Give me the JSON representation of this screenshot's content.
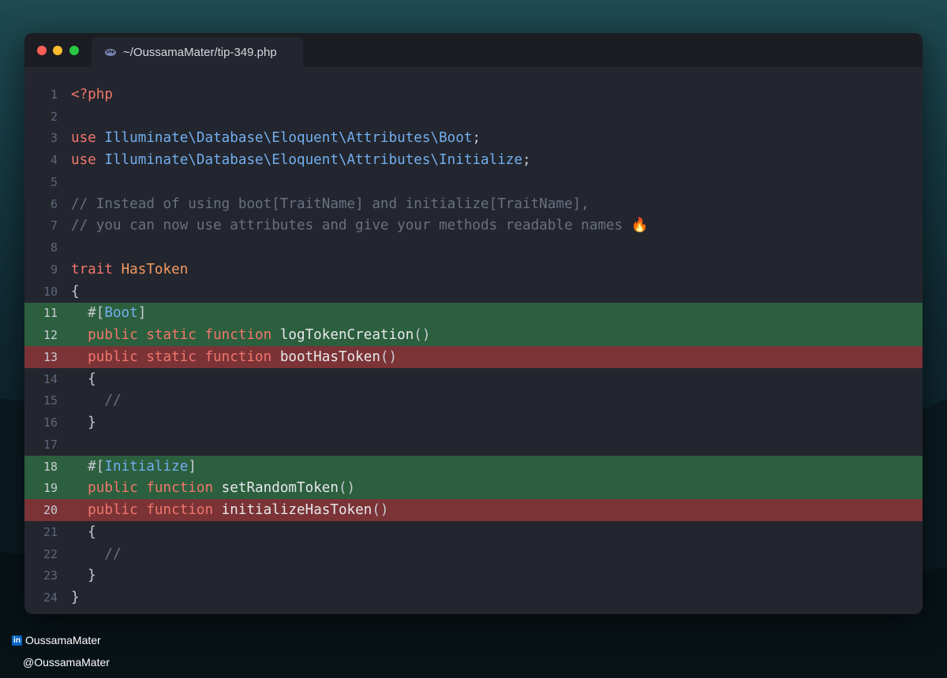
{
  "window": {
    "tab_title": "~/OussamaMater/tip-349.php",
    "file_icon": "php-icon"
  },
  "code_lines": [
    {
      "n": "1",
      "status": "normal",
      "tokens": [
        {
          "t": "<?php",
          "c": "kw"
        }
      ]
    },
    {
      "n": "2",
      "status": "normal",
      "tokens": []
    },
    {
      "n": "3",
      "status": "normal",
      "tokens": [
        {
          "t": "use ",
          "c": "kw"
        },
        {
          "t": "Illuminate\\Database\\Eloquent\\Attributes\\Boot",
          "c": "ns"
        },
        {
          "t": ";",
          "c": "pl"
        }
      ]
    },
    {
      "n": "4",
      "status": "normal",
      "tokens": [
        {
          "t": "use ",
          "c": "kw"
        },
        {
          "t": "Illuminate\\Database\\Eloquent\\Attributes\\Initialize",
          "c": "ns"
        },
        {
          "t": ";",
          "c": "pl"
        }
      ]
    },
    {
      "n": "5",
      "status": "normal",
      "tokens": []
    },
    {
      "n": "6",
      "status": "normal",
      "tokens": [
        {
          "t": "// Instead of using boot[TraitName] and initialize[TraitName],",
          "c": "cm"
        }
      ]
    },
    {
      "n": "7",
      "status": "normal",
      "tokens": [
        {
          "t": "// you can now use attributes and give your methods readable names 🔥",
          "c": "cm"
        }
      ]
    },
    {
      "n": "8",
      "status": "normal",
      "tokens": []
    },
    {
      "n": "9",
      "status": "normal",
      "tokens": [
        {
          "t": "trait ",
          "c": "kw"
        },
        {
          "t": "HasToken",
          "c": "ty"
        }
      ]
    },
    {
      "n": "10",
      "status": "normal",
      "tokens": [
        {
          "t": "{",
          "c": "pl"
        }
      ]
    },
    {
      "n": "11",
      "status": "added",
      "tokens": [
        {
          "t": "  #[",
          "c": "pl"
        },
        {
          "t": "Boot",
          "c": "ns"
        },
        {
          "t": "]",
          "c": "pl"
        }
      ]
    },
    {
      "n": "12",
      "status": "added",
      "tokens": [
        {
          "t": "  public static function ",
          "c": "kw"
        },
        {
          "t": "logTokenCreation",
          "c": "fn"
        },
        {
          "t": "()",
          "c": "pl"
        }
      ]
    },
    {
      "n": "13",
      "status": "removed",
      "tokens": [
        {
          "t": "  public static function ",
          "c": "kw"
        },
        {
          "t": "bootHasToken",
          "c": "fn"
        },
        {
          "t": "()",
          "c": "pl"
        }
      ]
    },
    {
      "n": "14",
      "status": "normal",
      "tokens": [
        {
          "t": "  {",
          "c": "pl"
        }
      ]
    },
    {
      "n": "15",
      "status": "normal",
      "tokens": [
        {
          "t": "    //",
          "c": "cm"
        }
      ]
    },
    {
      "n": "16",
      "status": "normal",
      "tokens": [
        {
          "t": "  }",
          "c": "pl"
        }
      ]
    },
    {
      "n": "17",
      "status": "normal",
      "tokens": []
    },
    {
      "n": "18",
      "status": "added",
      "tokens": [
        {
          "t": "  #[",
          "c": "pl"
        },
        {
          "t": "Initialize",
          "c": "ns"
        },
        {
          "t": "]",
          "c": "pl"
        }
      ]
    },
    {
      "n": "19",
      "status": "added",
      "tokens": [
        {
          "t": "  public function ",
          "c": "kw"
        },
        {
          "t": "setRandomToken",
          "c": "fn"
        },
        {
          "t": "()",
          "c": "pl"
        }
      ]
    },
    {
      "n": "20",
      "status": "removed",
      "tokens": [
        {
          "t": "  public function ",
          "c": "kw"
        },
        {
          "t": "initializeHasToken",
          "c": "fn"
        },
        {
          "t": "()",
          "c": "pl"
        }
      ]
    },
    {
      "n": "21",
      "status": "normal",
      "tokens": [
        {
          "t": "  {",
          "c": "pl"
        }
      ]
    },
    {
      "n": "22",
      "status": "normal",
      "tokens": [
        {
          "t": "    //",
          "c": "cm"
        }
      ]
    },
    {
      "n": "23",
      "status": "normal",
      "tokens": [
        {
          "t": "  }",
          "c": "pl"
        }
      ]
    },
    {
      "n": "24",
      "status": "normal",
      "tokens": [
        {
          "t": "}",
          "c": "pl"
        }
      ]
    }
  ],
  "footer": {
    "linkedin_icon_text": "in",
    "linkedin_handle": "OussamaMater",
    "x_handle": "@OussamaMater"
  }
}
